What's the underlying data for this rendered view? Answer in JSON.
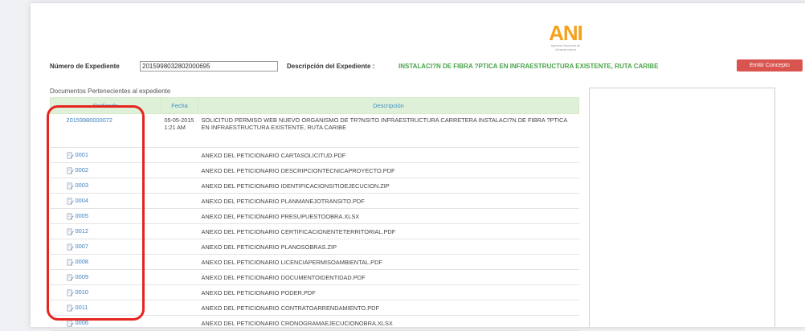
{
  "logo": {
    "text": "ANI",
    "subtitle": "Agencia Nacional de Infraestructura"
  },
  "header": {
    "expediente_label": "Número de Expediente",
    "expediente_value": "2015998032802000695",
    "descripcion_label": "Descripción del Expediente :",
    "descripcion_value": "INSTALACI?N DE FIBRA ?PTICA EN INFRAESTRUCTURA EXISTENTE, RUTA CARIBE",
    "emit_button": "Emitir Concepto"
  },
  "documents": {
    "section_label": "Documentos Pertenecientes al expediente",
    "columns": [
      "Radicado",
      "Fecha",
      "Descripción"
    ],
    "rows": [
      {
        "radicado": "20159980000072",
        "fecha": "05-05-2015 1:21 AM",
        "descripcion": "SOLICITUD PERMISO WEB NUEVO ORGANISMO DE TR?NSITO INFRAESTRUCTURA CARRETERA INSTALACI?N DE FIBRA ?PTICA EN INFRAESTRUCTURA EXISTENTE, RUTA CARIBE"
      },
      {
        "radicado": "0001",
        "fecha": "",
        "descripcion": "ANEXO DEL PETICIONARIO CARTASOLICITUD.PDF"
      },
      {
        "radicado": "0002",
        "fecha": "",
        "descripcion": "ANEXO DEL PETICIONARIO DESCRIPCIONTECNICAPROYECTO.PDF"
      },
      {
        "radicado": "0003",
        "fecha": "",
        "descripcion": "ANEXO DEL PETICIONARIO IDENTIFICACIONSITIOEJECUCION.ZIP"
      },
      {
        "radicado": "0004",
        "fecha": "",
        "descripcion": "ANEXO DEL PETICIONARIO PLANMANEJOTRANSITO.PDF"
      },
      {
        "radicado": "0005",
        "fecha": "",
        "descripcion": "ANEXO DEL PETICIONARIO PRESUPUESTOOBRA.XLSX"
      },
      {
        "radicado": "0012",
        "fecha": "",
        "descripcion": "ANEXO DEL PETICIONARIO CERTIFICACIONENTETERRITORIAL.PDF"
      },
      {
        "radicado": "0007",
        "fecha": "",
        "descripcion": "ANEXO DEL PETICIONARIO PLANOSOBRAS.ZIP"
      },
      {
        "radicado": "0008",
        "fecha": "",
        "descripcion": "ANEXO DEL PETICIONARIO LICENCIAPERMISOAMBIENTAL.PDF"
      },
      {
        "radicado": "0009",
        "fecha": "",
        "descripcion": "ANEXO DEL PETICIONARIO DOCUMENTOIDENTIDAD.PDF"
      },
      {
        "radicado": "0010",
        "fecha": "",
        "descripcion": "ANEXO DEL PETICIONARIO PODER.PDF"
      },
      {
        "radicado": "0011",
        "fecha": "",
        "descripcion": "ANEXO DEL PETICIONARIO CONTRATOARRENDAMIENTO.PDF"
      },
      {
        "radicado": "0006",
        "fecha": "",
        "descripcion": "ANEXO DEL PETICIONARIO CRONOGRAMAEJECUCIONOBRA.XLSX"
      }
    ]
  },
  "colors": {
    "accent_green": "#4aa34a",
    "header_green": "#dff0d8",
    "link_blue": "#3c7fbf",
    "highlight_red": "#e52520",
    "button_red": "#d9534f",
    "logo_orange": "#f5a11b"
  },
  "icons": {
    "attachment": "document-edit-icon"
  }
}
